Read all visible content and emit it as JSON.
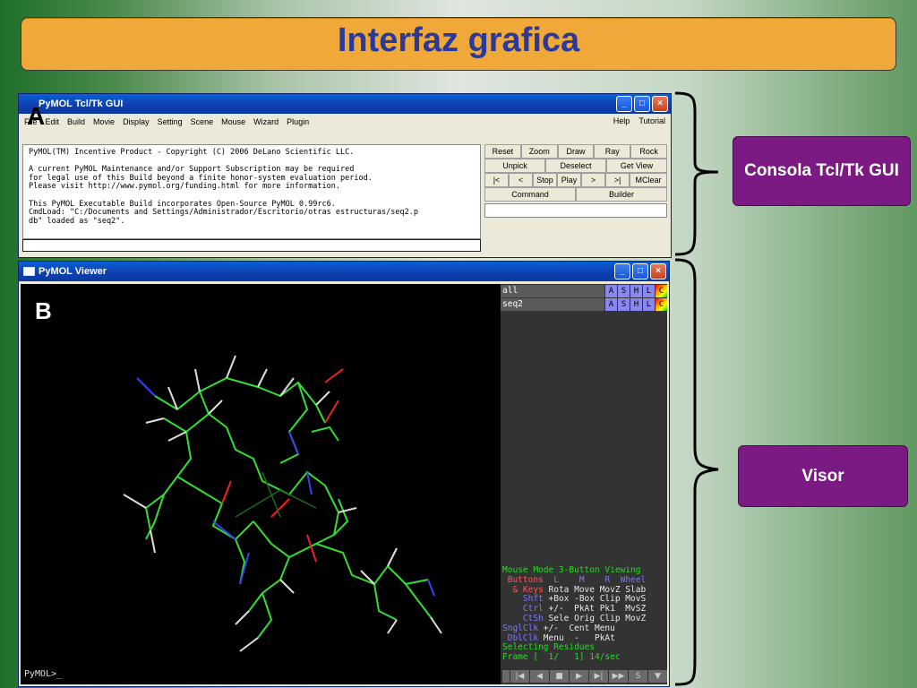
{
  "slide": {
    "title": "Interfaz grafica"
  },
  "tk": {
    "window_title": "PyMOL Tcl/Tk GUI",
    "label": "A",
    "menu": [
      "File",
      "Edit",
      "Build",
      "Movie",
      "Display",
      "Setting",
      "Scene",
      "Mouse",
      "Wizard",
      "Plugin"
    ],
    "menu_right": [
      "Help",
      "Tutorial"
    ],
    "console_lines": [
      "PyMOL(TM) Incentive Product - Copyright (C) 2006 DeLano Scientific LLC.",
      "",
      "A current PyMOL Maintenance and/or Support Subscription may be required",
      "for legal use of this Build beyond a finite honor-system evaluation period.",
      "Please visit http://www.pymol.org/funding.html for more information.",
      "",
      "This PyMOL Executable Build incorporates Open-Source PyMOL 0.99rc6.",
      "CmdLoad: \"C:/Documents and Settings/Administrador/Escritorio/otras estructuras/seq2.p",
      "db\" loaded as \"seq2\"."
    ],
    "buttons": {
      "row1": [
        "Reset",
        "Zoom",
        "Draw",
        "Ray",
        "Rock"
      ],
      "row2": [
        "Unpick",
        "Deselect",
        "Get View"
      ],
      "row3": [
        "|<",
        "<",
        "Stop",
        "Play",
        ">",
        ">|",
        "MClear"
      ],
      "row4": [
        "Command",
        "Builder"
      ]
    }
  },
  "viewer": {
    "window_title": "PyMOL Viewer",
    "label": "B",
    "prompt": "PyMOL>_",
    "objects": [
      {
        "name": "all",
        "buttons": [
          "A",
          "S",
          "H",
          "L",
          "C"
        ]
      },
      {
        "name": "seq2",
        "buttons": [
          "A",
          "S",
          "H",
          "L",
          "C"
        ]
      }
    ],
    "mouse_mode": {
      "line1": "Mouse Mode 3-Button Viewing",
      "header_left": " Buttons",
      "header_cols": [
        "L",
        "M",
        "R",
        "Wheel"
      ],
      "keys_label": "  & Keys",
      "keys_row": "Rota Move MovZ Slab",
      "rows": [
        {
          "k": "    Shft",
          "v": "+Box -Box Clip MovS"
        },
        {
          "k": "    Ctrl",
          "v": "+/-  PkAt Pk1  MvSZ"
        },
        {
          "k": "    CtSh",
          "v": "Sele Orig Clip MovZ"
        },
        {
          "k": "SnglClk",
          "v": "+/-  Cent Menu"
        },
        {
          "k": " DblClk",
          "v": "Menu  -   PkAt"
        }
      ],
      "selecting": "Selecting Residues",
      "frame": "Frame [  1/   1] 14/sec"
    },
    "frame_buttons": [
      "|◀",
      "◀",
      "■",
      "▶",
      "▶|",
      "▶▶",
      "S",
      "▼"
    ]
  },
  "annotations": {
    "consola": "Consola Tcl/Tk GUI",
    "visor": "Visor"
  },
  "colors": {
    "title_bar": "#f0a838",
    "annotation_box": "#7a1a82",
    "title_text": "#2b3a9a"
  }
}
